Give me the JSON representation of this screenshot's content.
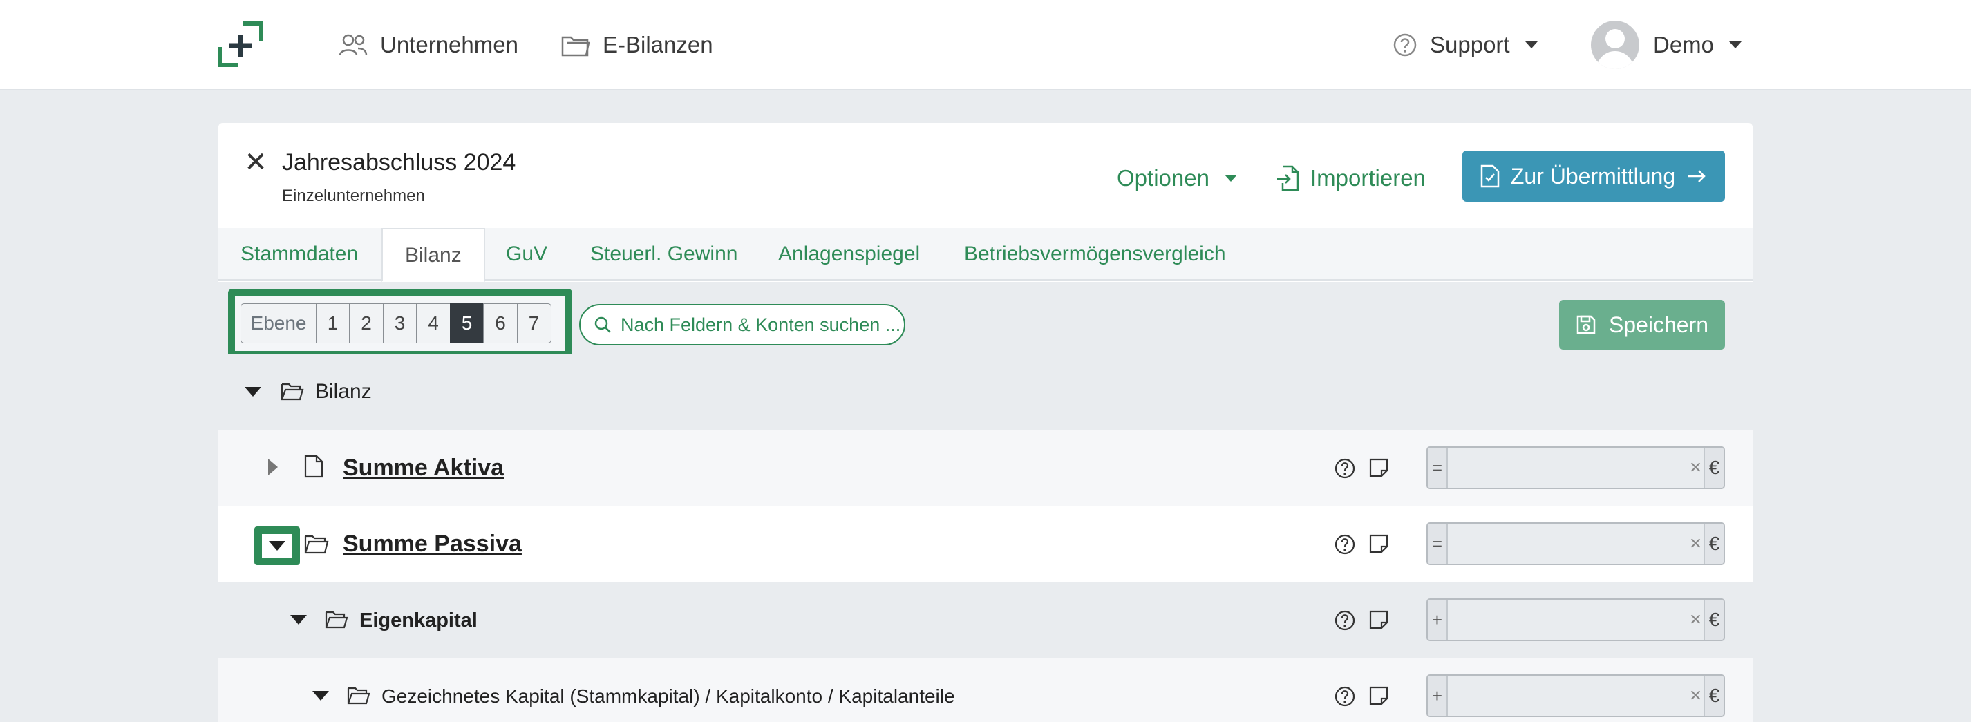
{
  "nav": {
    "unternehmen": "Unternehmen",
    "ebilanzen": "E-Bilanzen",
    "support": "Support",
    "user": "Demo"
  },
  "header": {
    "title": "Jahresabschluss 2024",
    "subtitle": "Einzelunternehmen",
    "optionen": "Optionen",
    "importieren": "Importieren",
    "submit": "Zur Übermittlung"
  },
  "tabs": [
    {
      "label": "Stammdaten"
    },
    {
      "label": "Bilanz",
      "active": true
    },
    {
      "label": "GuV"
    },
    {
      "label": "Steuerl. Gewinn"
    },
    {
      "label": "Anlagenspiegel"
    },
    {
      "label": "Betriebsvermögensvergleich"
    }
  ],
  "toolbar": {
    "level_label": "Ebene",
    "levels": [
      "1",
      "2",
      "3",
      "4",
      "5",
      "6",
      "7"
    ],
    "active_level": "5",
    "search_placeholder": "Nach Feldern & Konten suchen ...",
    "save": "Speichern"
  },
  "tree": {
    "root": "Bilanz",
    "rows": [
      {
        "label": "Summe Aktiva",
        "op": "=",
        "value": "",
        "currency": "€"
      },
      {
        "label": "Summe Passiva",
        "op": "=",
        "value": "",
        "currency": "€"
      },
      {
        "label": "Eigenkapital",
        "op": "+",
        "value": "",
        "currency": "€"
      },
      {
        "label": "Gezeichnetes Kapital (Stammkapital) / Kapitalkonto / Kapitalanteile",
        "op": "+",
        "value": "",
        "currency": "€"
      }
    ]
  },
  "colors": {
    "brand_green": "#2e8b57",
    "submit_blue": "#3b96b5",
    "save_green": "#6aaf8e"
  },
  "icons": {
    "logo": "logo-icon",
    "unternehmen": "users-icon",
    "ebilanzen": "folder-icon",
    "support": "question-circle-icon",
    "importieren": "file-import-icon",
    "submit": "file-check-icon",
    "search": "search-icon",
    "save": "floppy-disk-icon"
  }
}
